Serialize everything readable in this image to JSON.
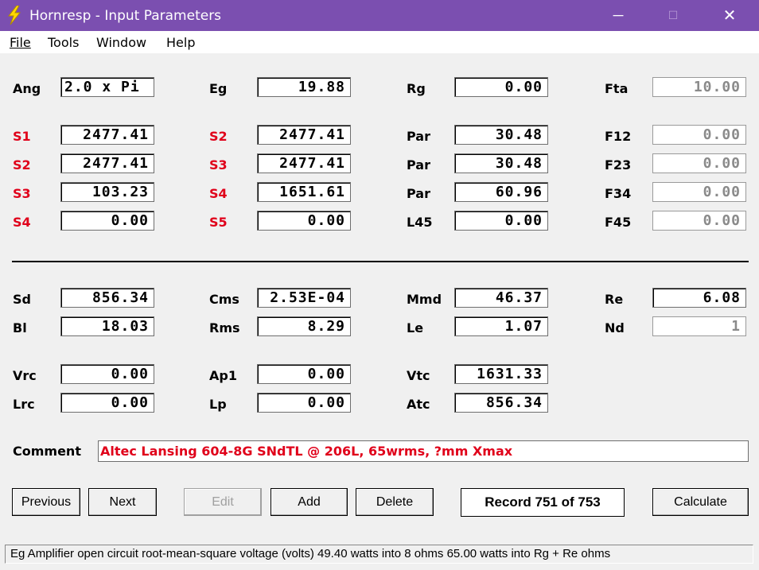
{
  "window": {
    "title": "Hornresp - Input Parameters",
    "minimize": "─",
    "maximize": "☐",
    "close": "✕"
  },
  "menu": [
    "File",
    "Tools",
    "Window",
    "Help"
  ],
  "rows": [
    {
      "cells": [
        {
          "label": "Ang",
          "red": false,
          "value": "2.0 x Pi",
          "disabled": false,
          "align": "left"
        },
        {
          "label": "Eg",
          "red": false,
          "value": "19.88",
          "disabled": false
        },
        {
          "label": "Rg",
          "red": false,
          "value": "0.00",
          "disabled": false
        },
        {
          "label": "Fta",
          "red": false,
          "value": "10.00",
          "disabled": true
        }
      ]
    },
    {
      "cells": [
        {
          "label": "S1",
          "red": true,
          "value": "2477.41",
          "disabled": false
        },
        {
          "label": "S2",
          "red": true,
          "value": "2477.41",
          "disabled": false
        },
        {
          "label": "Par",
          "red": false,
          "value": "30.48",
          "disabled": false
        },
        {
          "label": "F12",
          "red": false,
          "value": "0.00",
          "disabled": true
        }
      ]
    },
    {
      "cells": [
        {
          "label": "S2",
          "red": true,
          "value": "2477.41",
          "disabled": false
        },
        {
          "label": "S3",
          "red": true,
          "value": "2477.41",
          "disabled": false
        },
        {
          "label": "Par",
          "red": false,
          "value": "30.48",
          "disabled": false
        },
        {
          "label": "F23",
          "red": false,
          "value": "0.00",
          "disabled": true
        }
      ]
    },
    {
      "cells": [
        {
          "label": "S3",
          "red": true,
          "value": "103.23",
          "disabled": false
        },
        {
          "label": "S4",
          "red": true,
          "value": "1651.61",
          "disabled": false
        },
        {
          "label": "Par",
          "red": false,
          "value": "60.96",
          "disabled": false
        },
        {
          "label": "F34",
          "red": false,
          "value": "0.00",
          "disabled": true
        }
      ]
    },
    {
      "cells": [
        {
          "label": "S4",
          "red": true,
          "value": "0.00",
          "disabled": false
        },
        {
          "label": "S5",
          "red": true,
          "value": "0.00",
          "disabled": false
        },
        {
          "label": "L45",
          "red": false,
          "value": "0.00",
          "disabled": false
        },
        {
          "label": "F45",
          "red": false,
          "value": "0.00",
          "disabled": true
        }
      ]
    },
    {
      "cells": [
        {
          "label": "Sd",
          "red": false,
          "value": "856.34",
          "disabled": false
        },
        {
          "label": "Cms",
          "red": false,
          "value": "2.53E-04",
          "disabled": false
        },
        {
          "label": "Mmd",
          "red": false,
          "value": "46.37",
          "disabled": false
        },
        {
          "label": "Re",
          "red": false,
          "value": "6.08",
          "disabled": false
        }
      ]
    },
    {
      "cells": [
        {
          "label": "Bl",
          "red": false,
          "value": "18.03",
          "disabled": false
        },
        {
          "label": "Rms",
          "red": false,
          "value": "8.29",
          "disabled": false
        },
        {
          "label": "Le",
          "red": false,
          "value": "1.07",
          "disabled": false
        },
        {
          "label": "Nd",
          "red": false,
          "value": "1",
          "disabled": true
        }
      ]
    },
    {
      "cells": [
        {
          "label": "Vrc",
          "red": false,
          "value": "0.00",
          "disabled": false
        },
        {
          "label": "Ap1",
          "red": false,
          "value": "0.00",
          "disabled": false
        },
        {
          "label": "Vtc",
          "red": false,
          "value": "1631.33",
          "disabled": false
        }
      ]
    },
    {
      "cells": [
        {
          "label": "Lrc",
          "red": false,
          "value": "0.00",
          "disabled": false
        },
        {
          "label": "Lp",
          "red": false,
          "value": "0.00",
          "disabled": false
        },
        {
          "label": "Atc",
          "red": false,
          "value": "856.34",
          "disabled": false
        }
      ]
    }
  ],
  "comment": {
    "label": "Comment",
    "value": "Altec Lansing 604-8G SNdTL @ 206L, 65wrms, ?mm Xmax"
  },
  "buttons": {
    "previous": "Previous",
    "next": "Next",
    "edit": "Edit",
    "add": "Add",
    "delete": "Delete",
    "calculate": "Calculate"
  },
  "record": "Record 751 of 753",
  "status": "Eg  Amplifier open circuit root-mean-square voltage  (volts)   49.40 watts into 8 ohms   65.00 watts into Rg + Re ohms"
}
